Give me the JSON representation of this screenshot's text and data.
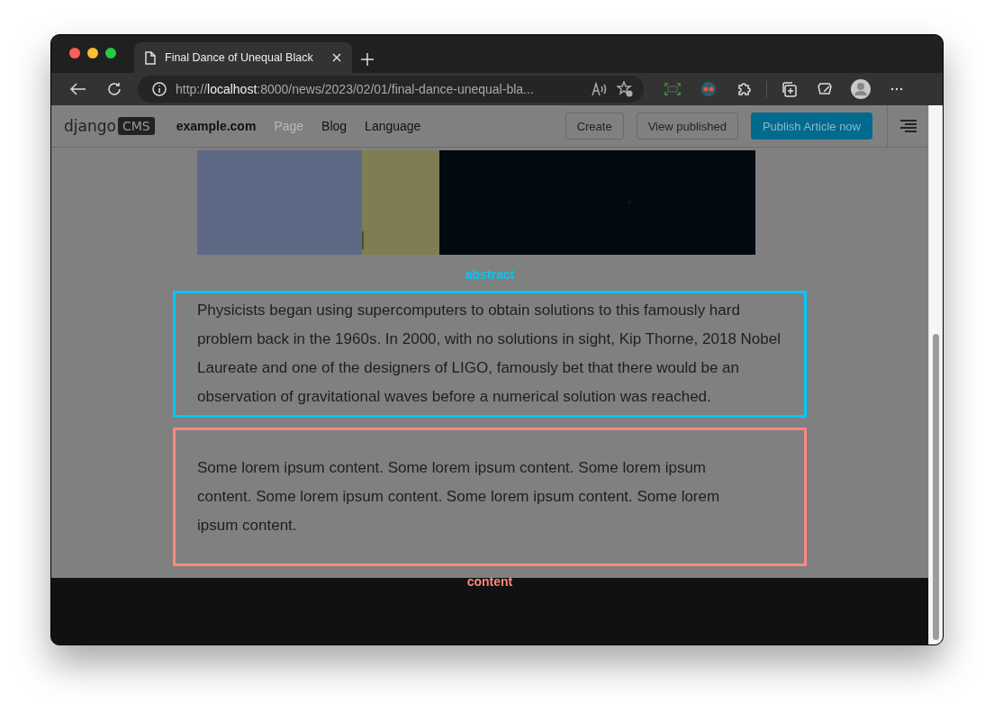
{
  "browser": {
    "tab_title": "Final Dance of Unequal Black",
    "url": {
      "scheme": "http://",
      "host": "localhost",
      "rest": ":8000/news/2023/02/01/final-dance-unequal-bla..."
    }
  },
  "cms_toolbar": {
    "logo_text": "django",
    "logo_badge": "CMS",
    "site": "example.com",
    "menu": [
      {
        "label": "Page",
        "disabled": true
      },
      {
        "label": "Blog",
        "disabled": false
      },
      {
        "label": "Language",
        "disabled": false
      }
    ],
    "buttons": [
      {
        "label": "Create",
        "kind": "default"
      },
      {
        "label": "View published",
        "kind": "default"
      },
      {
        "label": "Publish Article now",
        "kind": "primary"
      }
    ]
  },
  "article": {
    "placeholders": [
      {
        "kind": "label",
        "color": "#00c8f8",
        "text": "abstract"
      },
      {
        "kind": "box",
        "color": "#00c8f8",
        "text": "Physicists began using supercomputers to obtain solutions to this famously hard problem back in the 1960s. In 2000, with no solutions in sight, Kip Thorne, 2018 Nobel Laureate and one of the designers of LIGO, famously bet that there would be an observation of gravitational waves before a numerical solution was reached."
      },
      {
        "kind": "box",
        "color": "#f88a80",
        "text": "Some lorem ipsum content. Some lorem ipsum content. Some lorem ipsum content. Some lorem ipsum content. Some lorem ipsum content. Some lorem ipsum content."
      },
      {
        "kind": "label",
        "color": "#f88a80",
        "text": "content"
      }
    ]
  }
}
